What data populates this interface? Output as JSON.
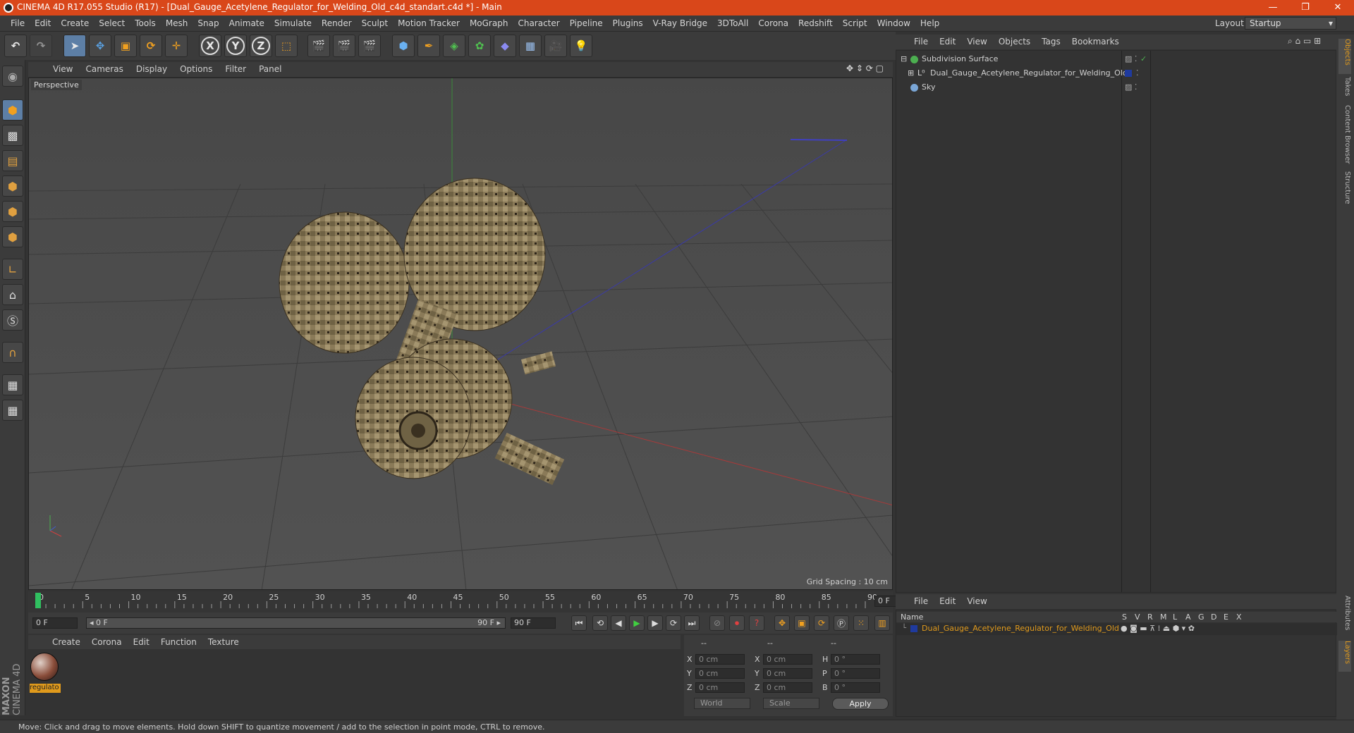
{
  "window": {
    "title": "CINEMA 4D R17.055 Studio (R17) - [Dual_Gauge_Acetylene_Regulator_for_Welding_Old_c4d_standart.c4d *] - Main",
    "minimize": "—",
    "restore": "❐",
    "close": "✕"
  },
  "menubar": {
    "items": [
      "File",
      "Edit",
      "Create",
      "Select",
      "Tools",
      "Mesh",
      "Snap",
      "Animate",
      "Simulate",
      "Render",
      "Sculpt",
      "Motion Tracker",
      "MoGraph",
      "Character",
      "Pipeline",
      "Plugins",
      "V-Ray Bridge",
      "3DToAll",
      "Corona",
      "Redshift",
      "Script",
      "Window",
      "Help"
    ],
    "layout_label": "Layout:",
    "layout_value": "Startup"
  },
  "toolbar": {
    "axis_x": "X",
    "axis_y": "Y",
    "axis_z": "Z"
  },
  "viewport": {
    "menu": [
      "View",
      "Cameras",
      "Display",
      "Options",
      "Filter",
      "Panel"
    ],
    "label": "Perspective",
    "grid_spacing": "Grid Spacing : 10 cm"
  },
  "timeline": {
    "ticks": [
      "0",
      "5",
      "10",
      "15",
      "20",
      "25",
      "30",
      "35",
      "40",
      "45",
      "50",
      "55",
      "60",
      "65",
      "70",
      "75",
      "80",
      "85",
      "90"
    ],
    "current_frame": "0 F",
    "start_field": "0 F",
    "range_start": "◂ 0 F",
    "range_end": "90 F ▸",
    "end_field": "90 F"
  },
  "material_manager": {
    "menu": [
      "Create",
      "Corona",
      "Edit",
      "Function",
      "Texture"
    ],
    "material_name": "regulato"
  },
  "coordinates": {
    "header": [
      "--",
      "--",
      "--"
    ],
    "rows": [
      {
        "a": "X",
        "av": "0 cm",
        "b": "X",
        "bv": "0 cm",
        "c": "H",
        "cv": "0 °"
      },
      {
        "a": "Y",
        "av": "0 cm",
        "b": "Y",
        "bv": "0 cm",
        "c": "P",
        "cv": "0 °"
      },
      {
        "a": "Z",
        "av": "0 cm",
        "b": "Z",
        "bv": "0 cm",
        "c": "B",
        "cv": "0 °"
      }
    ],
    "space": "World",
    "mode": "Scale",
    "apply": "Apply"
  },
  "status": "Move: Click and drag to move elements. Hold down SHIFT to quantize movement / add to the selection in point mode, CTRL to remove.",
  "object_manager": {
    "menu": [
      "File",
      "Edit",
      "View",
      "Objects",
      "Tags",
      "Bookmarks"
    ],
    "objects": [
      {
        "name": "Subdivision Surface",
        "color": "#4caf50"
      },
      {
        "name": "Dual_Gauge_Acetylene_Regulator_for_Welding_Old",
        "color": "#9ab"
      },
      {
        "name": "Sky",
        "color": "#7aa6d6"
      }
    ]
  },
  "right_tabs": [
    "Objects",
    "Takes",
    "Content Browser",
    "Structure",
    "Attributes",
    "Layers"
  ],
  "layer_manager": {
    "menu": [
      "File",
      "Edit",
      "View"
    ],
    "columns": [
      "Name",
      "S",
      "V",
      "R",
      "M",
      "L",
      "A",
      "G",
      "D",
      "E",
      "X"
    ],
    "layer_name": "Dual_Gauge_Acetylene_Regulator_for_Welding_Old",
    "layer_color": "#1f3a9e"
  },
  "brand": {
    "maxon": "MAXON",
    "c4d": "CINEMA 4D"
  }
}
